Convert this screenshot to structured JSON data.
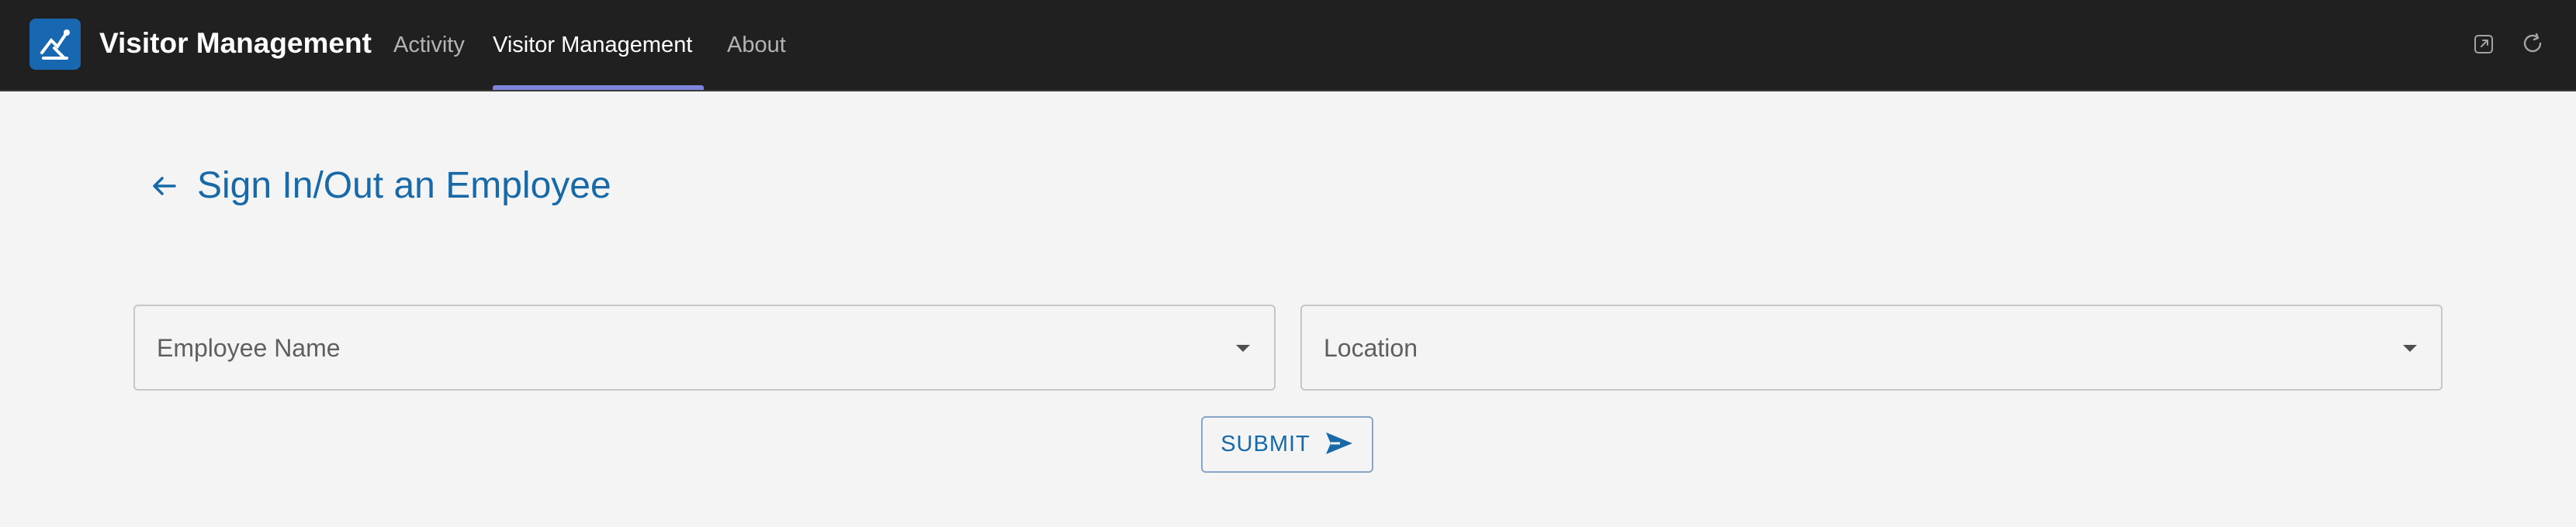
{
  "app": {
    "title": "Visitor Management",
    "icon": "visitor-app-icon",
    "brand_color": "#1768b0"
  },
  "nav": {
    "tabs": [
      {
        "label": "Activity",
        "active": false
      },
      {
        "label": "Visitor Management",
        "active": true
      },
      {
        "label": "About",
        "active": false
      }
    ],
    "active_indicator_color": "#7f84dd"
  },
  "toolbar": {
    "icons": [
      "open-external-icon",
      "refresh-icon"
    ]
  },
  "page": {
    "title": "Sign In/Out an Employee",
    "back_icon": "arrow-left-icon",
    "accent_color": "#1769a8"
  },
  "form": {
    "employee_name": {
      "label": "Employee Name",
      "value": ""
    },
    "location": {
      "label": "Location",
      "value": ""
    },
    "submit": {
      "label": "SUBMIT",
      "icon": "send-icon"
    }
  }
}
